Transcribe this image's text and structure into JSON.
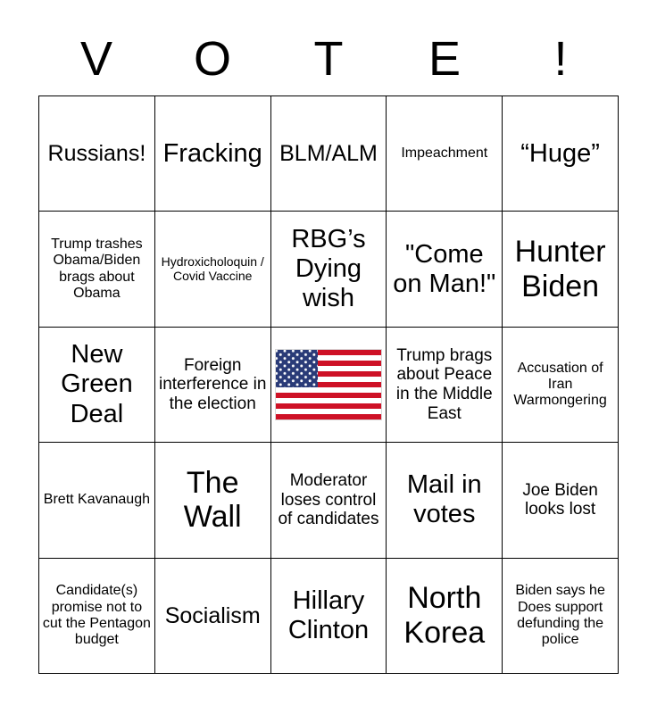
{
  "card": {
    "title_letters": [
      "V",
      "O",
      "T",
      "E",
      "!"
    ],
    "free_space_icon": "us-flag-icon"
  },
  "grid": {
    "rows": [
      [
        {
          "text": "Russians!",
          "size": "fs-md"
        },
        {
          "text": "Fracking",
          "size": "fs-lg"
        },
        {
          "text": "BLM/ALM",
          "size": "fs-md"
        },
        {
          "text": "Impeachment",
          "size": "fs-xs"
        },
        {
          "text": "“Huge”",
          "size": "fs-lg"
        }
      ],
      [
        {
          "text": "Trump trashes Obama/Biden brags about Obama",
          "size": "fs-xs"
        },
        {
          "text": "Hydroxicholoquin / Covid Vaccine",
          "size": "fs-xxs"
        },
        {
          "text": "RBG’s Dying wish",
          "size": "fs-lg"
        },
        {
          "text": "\"Come on Man!\"",
          "size": "fs-lg"
        },
        {
          "text": "Hunter Biden",
          "size": "fs-xl"
        }
      ],
      [
        {
          "text": "New Green Deal",
          "size": "fs-lg"
        },
        {
          "text": "Foreign interference in the election",
          "size": "fs-sm"
        },
        {
          "text": "",
          "size": "flag"
        },
        {
          "text": "Trump brags about Peace in the Middle East",
          "size": "fs-sm"
        },
        {
          "text": "Accusation of Iran Warmongering",
          "size": "fs-xs"
        }
      ],
      [
        {
          "text": "Brett Kavanaugh",
          "size": "fs-xs"
        },
        {
          "text": "The Wall",
          "size": "fs-xl"
        },
        {
          "text": "Moderator loses control of candidates",
          "size": "fs-sm"
        },
        {
          "text": "Mail in votes",
          "size": "fs-lg"
        },
        {
          "text": "Joe Biden looks lost",
          "size": "fs-sm"
        }
      ],
      [
        {
          "text": "Candidate(s) promise not to cut the Pentagon budget",
          "size": "fs-xs"
        },
        {
          "text": "Socialism",
          "size": "fs-md"
        },
        {
          "text": "Hillary Clinton",
          "size": "fs-lg"
        },
        {
          "text": "North Korea",
          "size": "fs-xl"
        },
        {
          "text": "Biden says he Does support defunding the police",
          "size": "fs-xs"
        }
      ]
    ]
  },
  "colors": {
    "border": "#000000",
    "background": "#ffffff",
    "text": "#000000",
    "flag_red": "#ce1126",
    "flag_blue": "#2a3b78",
    "flag_white": "#ffffff"
  }
}
